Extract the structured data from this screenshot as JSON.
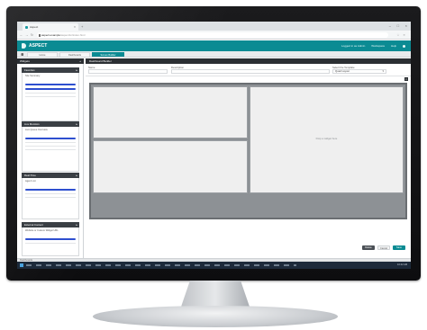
{
  "browser": {
    "tab_title": "Aspect",
    "url_host": "aspect.example",
    "url_path": "/aspect/ui/index.html"
  },
  "app": {
    "logo": "ASPECT",
    "header_links": [
      "Logged in as Admin",
      "Workspace",
      "Help"
    ],
    "tabs": [
      "Home",
      "Dashboards",
      "Screen Builder"
    ],
    "active_tab_index": 2,
    "accent_color": "#0b8b93"
  },
  "widgets": {
    "title": "Widgets",
    "groups": [
      {
        "title": "Favorites",
        "items": [
          "Site Summary"
        ]
      },
      {
        "title": "Live Monitors",
        "items": [
          "Live Queue Overview"
        ]
      },
      {
        "title": "Real-Time",
        "items": [
          "Agent List"
        ]
      },
      {
        "title": "External Content",
        "items": [
          "Website or Custom Widget URL"
        ]
      }
    ]
  },
  "editor": {
    "title": "Dashboard Builder",
    "name_label": "Name",
    "description_label": "Description",
    "layout_label": "Select the Template",
    "layout_value": "Quad Layout",
    "empty_cell_text": "Drop a widget here",
    "buttons": {
      "delete": "Delete",
      "cancel": "Cancel",
      "save": "Save"
    }
  },
  "status": {
    "strip_text": "Dashboards",
    "clock": "10:42 AM"
  }
}
